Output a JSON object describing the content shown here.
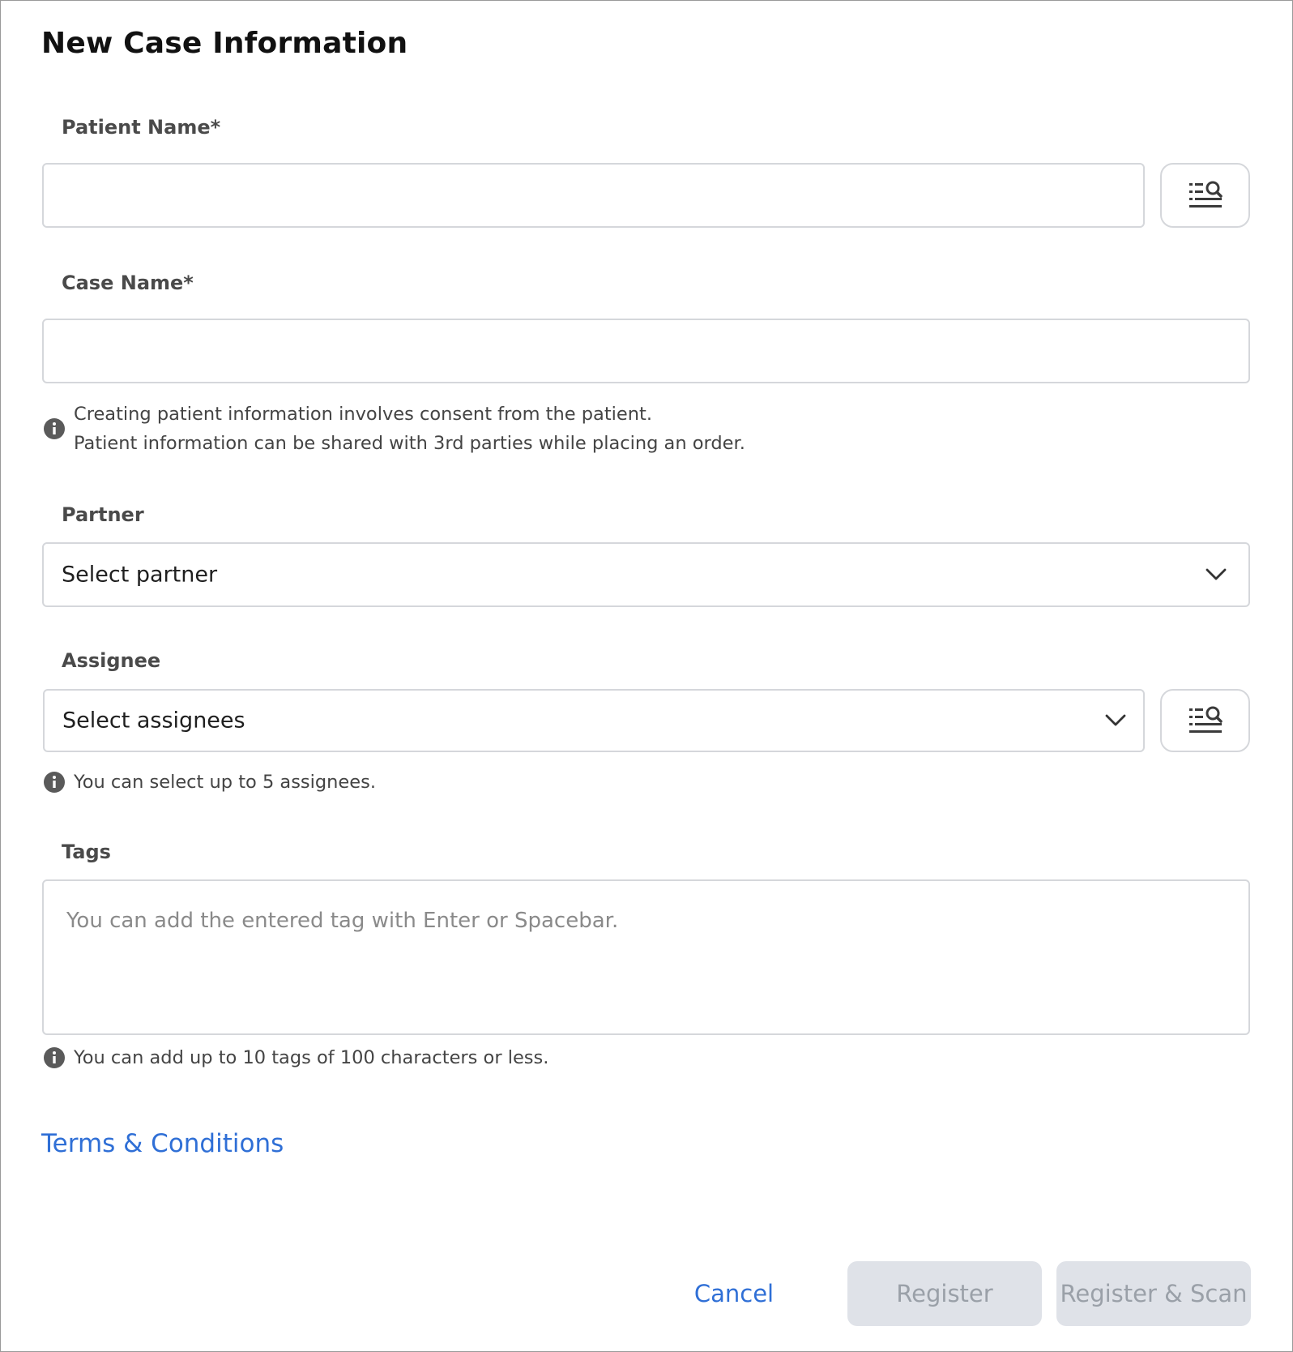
{
  "dialog": {
    "title": "New Case Information"
  },
  "patient": {
    "label": "Patient Name*",
    "value": "",
    "placeholder": "",
    "search_icon": "list-search-icon"
  },
  "case": {
    "label": "Case Name*",
    "value": "",
    "placeholder": ""
  },
  "consent_hint": {
    "icon": "info-icon",
    "line1": "Creating patient information involves consent from the patient.",
    "line2": "Patient information can be shared with 3rd parties while placing an order."
  },
  "partner": {
    "label": "Partner",
    "selected": "Select partner",
    "icon": "chevron-down-icon"
  },
  "assignee": {
    "label": "Assignee",
    "selected": "Select assignees",
    "icon": "chevron-down-icon",
    "search_icon": "list-search-icon",
    "hint": "You can select up to 5 assignees."
  },
  "tags": {
    "label": "Tags",
    "placeholder": "You can add the entered tag with Enter or Spacebar.",
    "hint": "You can add up to 10 tags of 100 characters or less."
  },
  "terms": {
    "label": "Terms & Conditions"
  },
  "actions": {
    "cancel": "Cancel",
    "register": "Register",
    "register_scan": "Register & Scan"
  },
  "colors": {
    "accent": "#2f6fd6",
    "border": "#d5d7db",
    "disabled_bg": "#dfe2e8",
    "disabled_text": "#9aa0a8",
    "info_icon": "#5a5a5a"
  }
}
